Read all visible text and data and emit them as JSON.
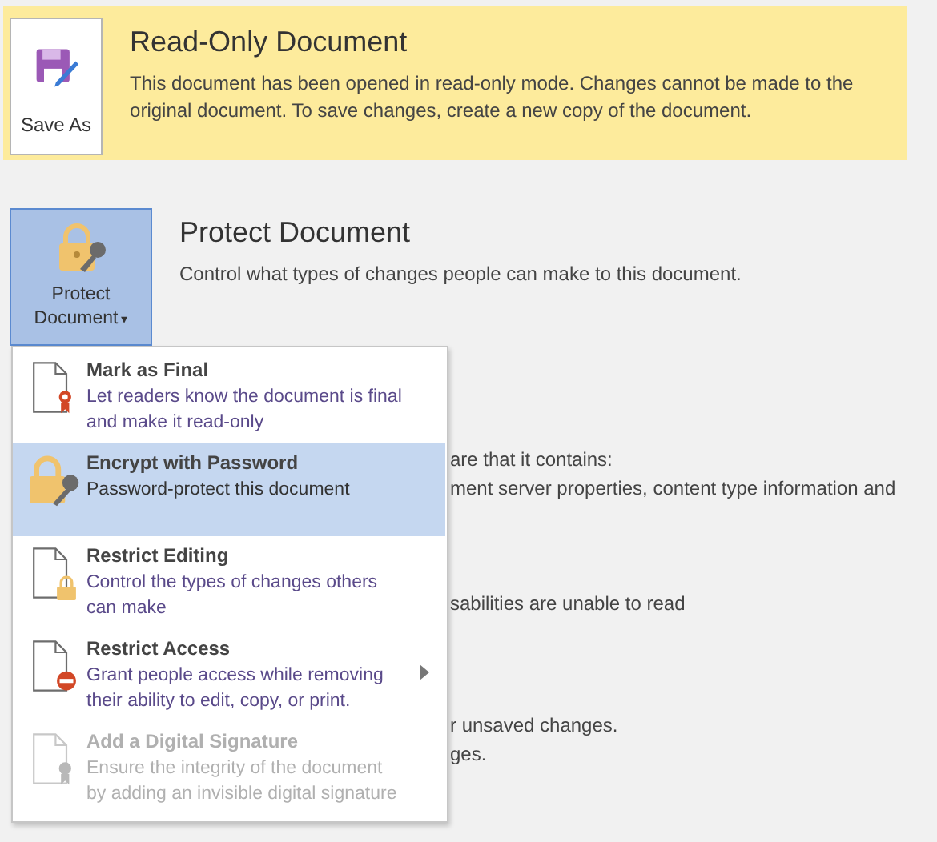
{
  "read_only_banner": {
    "button": {
      "label": "Save As"
    },
    "title": "Read-Only Document",
    "text": "This document has been opened in read-only mode. Changes cannot be made to the original document. To save changes, create a new copy of the document."
  },
  "protect_section": {
    "button": {
      "label_line_1": "Protect",
      "label_line_2": "Document",
      "caret": "▾",
      "expanded": true
    },
    "title": "Protect Document",
    "text": "Control what types of changes people can make to this document."
  },
  "background_text": [
    "are that it contains:",
    "ment server properties, content type information and",
    "sabilities are unable to read",
    "r unsaved changes.",
    "ges."
  ],
  "menu": {
    "items": [
      {
        "kind": "final",
        "title": "Mark as Final",
        "description": "Let readers know the document is final and make it read-only",
        "selected": false,
        "disabled": false,
        "submenu": false
      },
      {
        "kind": "encrypt",
        "title": "Encrypt with Password",
        "description": "Password-protect this document",
        "selected": true,
        "disabled": false,
        "submenu": false
      },
      {
        "kind": "restrict_editing",
        "title": "Restrict Editing",
        "description": "Control the types of changes others can make",
        "selected": false,
        "disabled": false,
        "submenu": false
      },
      {
        "kind": "restrict_access",
        "title": "Restrict Access",
        "description": "Grant people access while removing their ability to edit, copy, or print.",
        "selected": false,
        "disabled": false,
        "submenu": true
      },
      {
        "kind": "signature",
        "title": "Add a Digital Signature",
        "description": "Ensure the integrity of the document by adding an invisible digital signature",
        "selected": false,
        "disabled": true,
        "submenu": false
      }
    ]
  }
}
